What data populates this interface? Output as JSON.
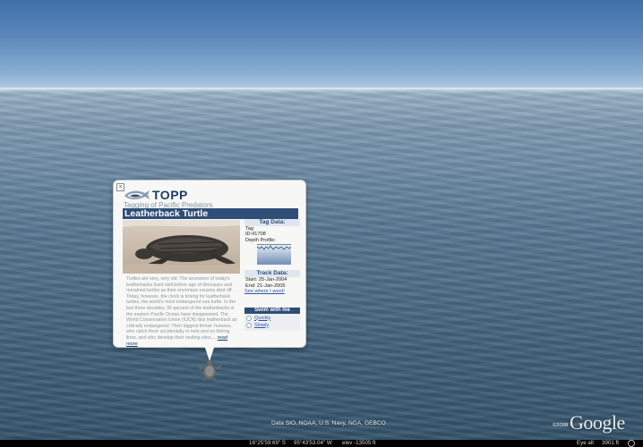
{
  "balloon": {
    "close_glyph": "×",
    "logo_text": "TOPP",
    "subtitle": "Tagging of Pacific Predators",
    "title": "Leatherback Turtle",
    "description": "Turtles are very, very old. The ancestors of today's leatherbacks lived well before age of dinosaurs and remained turtles as their enormous cousins died off. Today, however, the clock is ticking for leatherback turtles, the world's most endangered sea turtle. In the last three decades, 95 percent of the leatherbacks in the eastern Pacific Ocean have disappeared. The World Conservation Union (IUCN) lists leatherback as critically endangered. Their biggest threat: humans, who catch them accidentally in nets and on fishing lines, and who develop their nesting sites....",
    "read_more": "read more",
    "tag_data": {
      "heading": "Tag Data:",
      "tag_label": "Tag",
      "id_label": "ID:41708",
      "depth_label": "Depth Profile:"
    },
    "track_data": {
      "heading": "Track Data:",
      "start": "Start: 25-Jan-2004",
      "end": "End: 21-Jan-2005",
      "see_link": "See where I went!"
    },
    "swim": {
      "heading": "Swim with me",
      "options": [
        "Quickly",
        "Slowly"
      ]
    }
  },
  "footer": {
    "data_credit": "Data SIO, NOAA, U.S. Navy, NGA, GEBCO",
    "copyright": "©2008",
    "google_logo": "Google"
  },
  "status_bar": {
    "latitude": "16°25'59.69\" S",
    "longitude": "95°43'53.04\" W",
    "elevation": "elev -13505 ft",
    "eye_alt_label": "Eye alt",
    "eye_alt_value": "3901 ft"
  },
  "colors": {
    "brand_navy": "#2e4d77",
    "sky": "#5b87bb",
    "sea": "#587894"
  }
}
